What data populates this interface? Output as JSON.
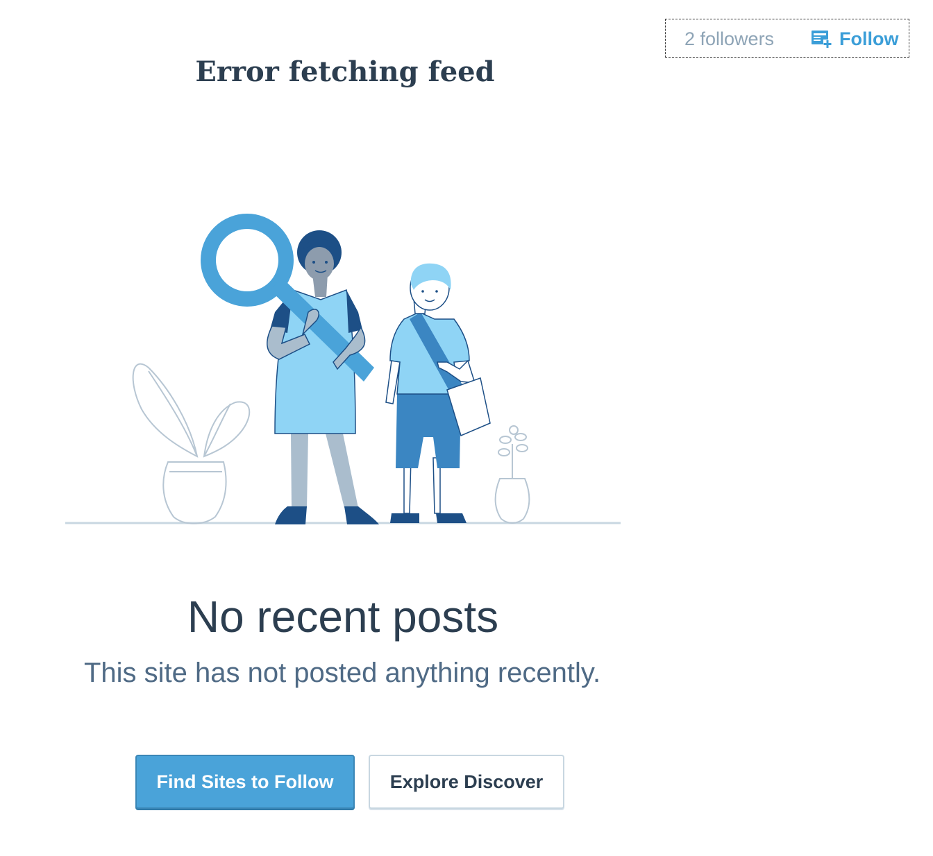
{
  "header": {
    "followers_text": "2 followers",
    "follow_label": "Follow",
    "feed_title": "Error fetching feed"
  },
  "empty_state": {
    "title": "No recent posts",
    "line": "This site has not posted anything recently.",
    "primary_action": "Find Sites to Follow",
    "secondary_action": "Explore Discover"
  },
  "illustration": {
    "subject": "two people with a magnifying glass between potted plants"
  },
  "colors": {
    "accent": "#4aa3d9",
    "follow_blue": "#3b9ed8",
    "text_dark": "#2c3e50",
    "text_muted": "#4f6a85",
    "followers_grey": "#8ea4b6"
  },
  "icons": {
    "follow": "reader-follow-icon"
  }
}
